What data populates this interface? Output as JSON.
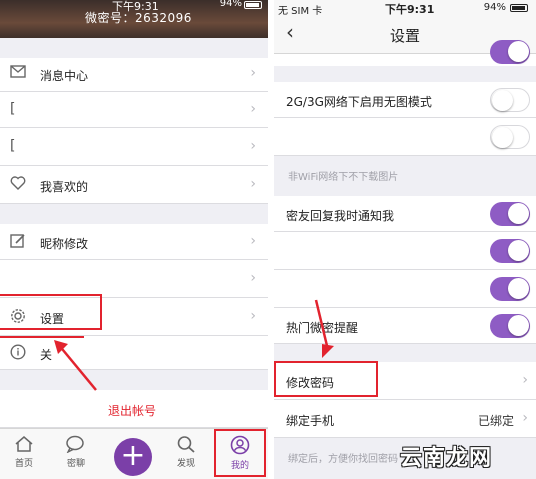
{
  "left": {
    "status": {
      "time": "下午9:31",
      "battery": "94%"
    },
    "profile": {
      "weimi_id": "微密号：2632096"
    },
    "menu": {
      "messages": "消息中心",
      "likes": "我喜欢的",
      "nickname": "昵称修改",
      "settings": "设置",
      "about": "关"
    },
    "annotation": "退出帐号",
    "tabs": [
      {
        "label": "首页",
        "icon": "home-icon"
      },
      {
        "label": "密聊",
        "icon": "chat-icon"
      },
      {
        "label": "发现",
        "icon": "search-icon"
      },
      {
        "label": "我的",
        "icon": "profile-icon"
      }
    ]
  },
  "right": {
    "status": {
      "carrier": "无 SIM 卡",
      "time": "下午9:31",
      "battery": "94%"
    },
    "nav": {
      "back": "‹",
      "title": "设置"
    },
    "rows": {
      "no_image_mode": "2G/3G网络下启用无图模式",
      "wifi_note": "非WiFi网络下不下载图片",
      "friend_reply": "密友回复我时通知我",
      "hot_reminder": "热门微密提醒",
      "change_password": "修改密码",
      "bind_phone": "绑定手机",
      "bind_phone_value": "已绑定",
      "bind_note": "绑定后，方便你找回密码"
    },
    "toggles": {
      "no_image_mode": false,
      "row2": false,
      "friend_reply": true,
      "row4": true,
      "row5": true,
      "hot_reminder": true
    }
  },
  "watermark": "云南龙网",
  "colors": {
    "accent": "#8e5cc4",
    "highlight": "#e2232e"
  }
}
